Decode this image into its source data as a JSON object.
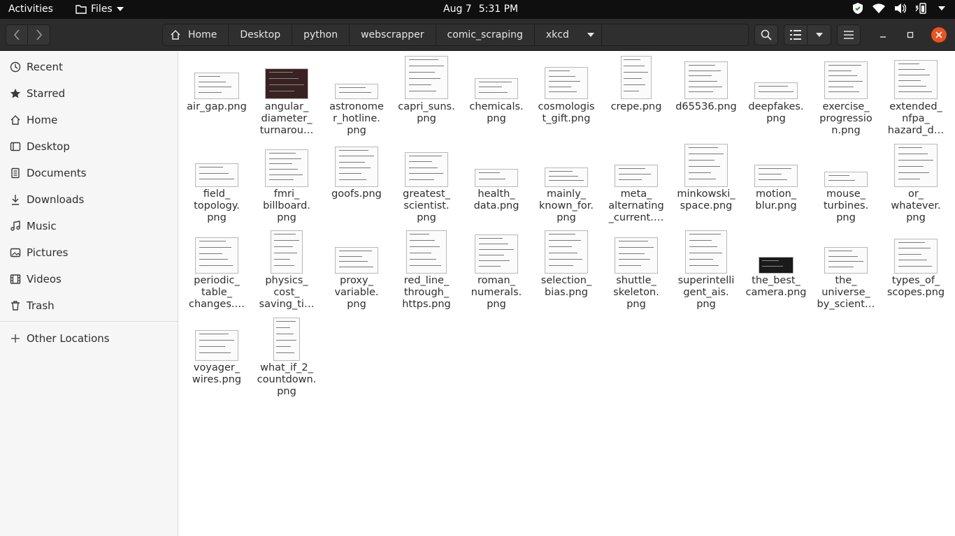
{
  "topbar": {
    "activities": "Activities",
    "app_name": "Files",
    "date": "Aug 7",
    "time": "5:31 PM"
  },
  "icons": {
    "back": "chevron-left-icon",
    "forward": "chevron-right-icon",
    "home": "home-icon",
    "search": "search-icon",
    "list_view": "list-view-icon",
    "menu": "hamburger-menu-icon",
    "minimize": "minimize-icon",
    "maximize": "maximize-icon",
    "close": "close-icon"
  },
  "colors": {
    "topbar_bg": "#0f0f0f",
    "header_bg": "#2c2c2c",
    "sidebar_bg": "#f6f6f6",
    "close_button": "#e95420"
  },
  "pathbar": {
    "crumbs": [
      "Home",
      "Desktop",
      "python",
      "webscrapper",
      "comic_scraping",
      "xkcd"
    ]
  },
  "sidebar": {
    "items": [
      {
        "label": "Recent",
        "icon": "clock-icon"
      },
      {
        "label": "Starred",
        "icon": "star-icon"
      },
      {
        "label": "Home",
        "icon": "home-icon"
      },
      {
        "label": "Desktop",
        "icon": "desktop-icon"
      },
      {
        "label": "Documents",
        "icon": "document-icon"
      },
      {
        "label": "Downloads",
        "icon": "download-icon"
      },
      {
        "label": "Music",
        "icon": "music-icon"
      },
      {
        "label": "Pictures",
        "icon": "picture-icon"
      },
      {
        "label": "Videos",
        "icon": "video-icon"
      },
      {
        "label": "Trash",
        "icon": "trash-icon"
      }
    ],
    "other_locations": "Other Locations"
  },
  "files": [
    {
      "label": "air_gap.png"
    },
    {
      "label": "angular_\ndiameter_\nturnarou…"
    },
    {
      "label": "astronome\nr_hotline.\npng"
    },
    {
      "label": "capri_suns.\npng"
    },
    {
      "label": "chemicals.\npng"
    },
    {
      "label": "cosmologis\nt_gift.png"
    },
    {
      "label": "crepe.png"
    },
    {
      "label": "d65536.png"
    },
    {
      "label": "deepfakes.\npng"
    },
    {
      "label": "exercise_\nprogressio\nn.png"
    },
    {
      "label": "extended_\nnfpa_\nhazard_d…"
    },
    {
      "label": "field_\ntopology.\npng"
    },
    {
      "label": "fmri_\nbillboard.\npng"
    },
    {
      "label": "goofs.png"
    },
    {
      "label": "greatest_\nscientist.\npng"
    },
    {
      "label": "health_\ndata.png"
    },
    {
      "label": "mainly_\nknown_for.\npng"
    },
    {
      "label": "meta_\nalternating\n_current.…"
    },
    {
      "label": "minkowski_\nspace.png"
    },
    {
      "label": "motion_\nblur.png"
    },
    {
      "label": "mouse_\nturbines.\npng"
    },
    {
      "label": "or_\nwhatever.\npng"
    },
    {
      "label": "periodic_\ntable_\nchanges.…"
    },
    {
      "label": "physics_\ncost_\nsaving_ti…"
    },
    {
      "label": "proxy_\nvariable.\npng"
    },
    {
      "label": "red_line_\nthrough_\nhttps.png"
    },
    {
      "label": "roman_\nnumerals.\npng"
    },
    {
      "label": "selection_\nbias.png"
    },
    {
      "label": "shuttle_\nskeleton.\npng"
    },
    {
      "label": "superintelli\ngent_ais.\npng"
    },
    {
      "label": "the_best_\ncamera.png"
    },
    {
      "label": "the_\nuniverse_\nby_scient…"
    },
    {
      "label": "types_of_\nscopes.png"
    },
    {
      "label": "voyager_\nwires.png"
    },
    {
      "label": "what_if_2_\ncountdown.\npng"
    }
  ]
}
